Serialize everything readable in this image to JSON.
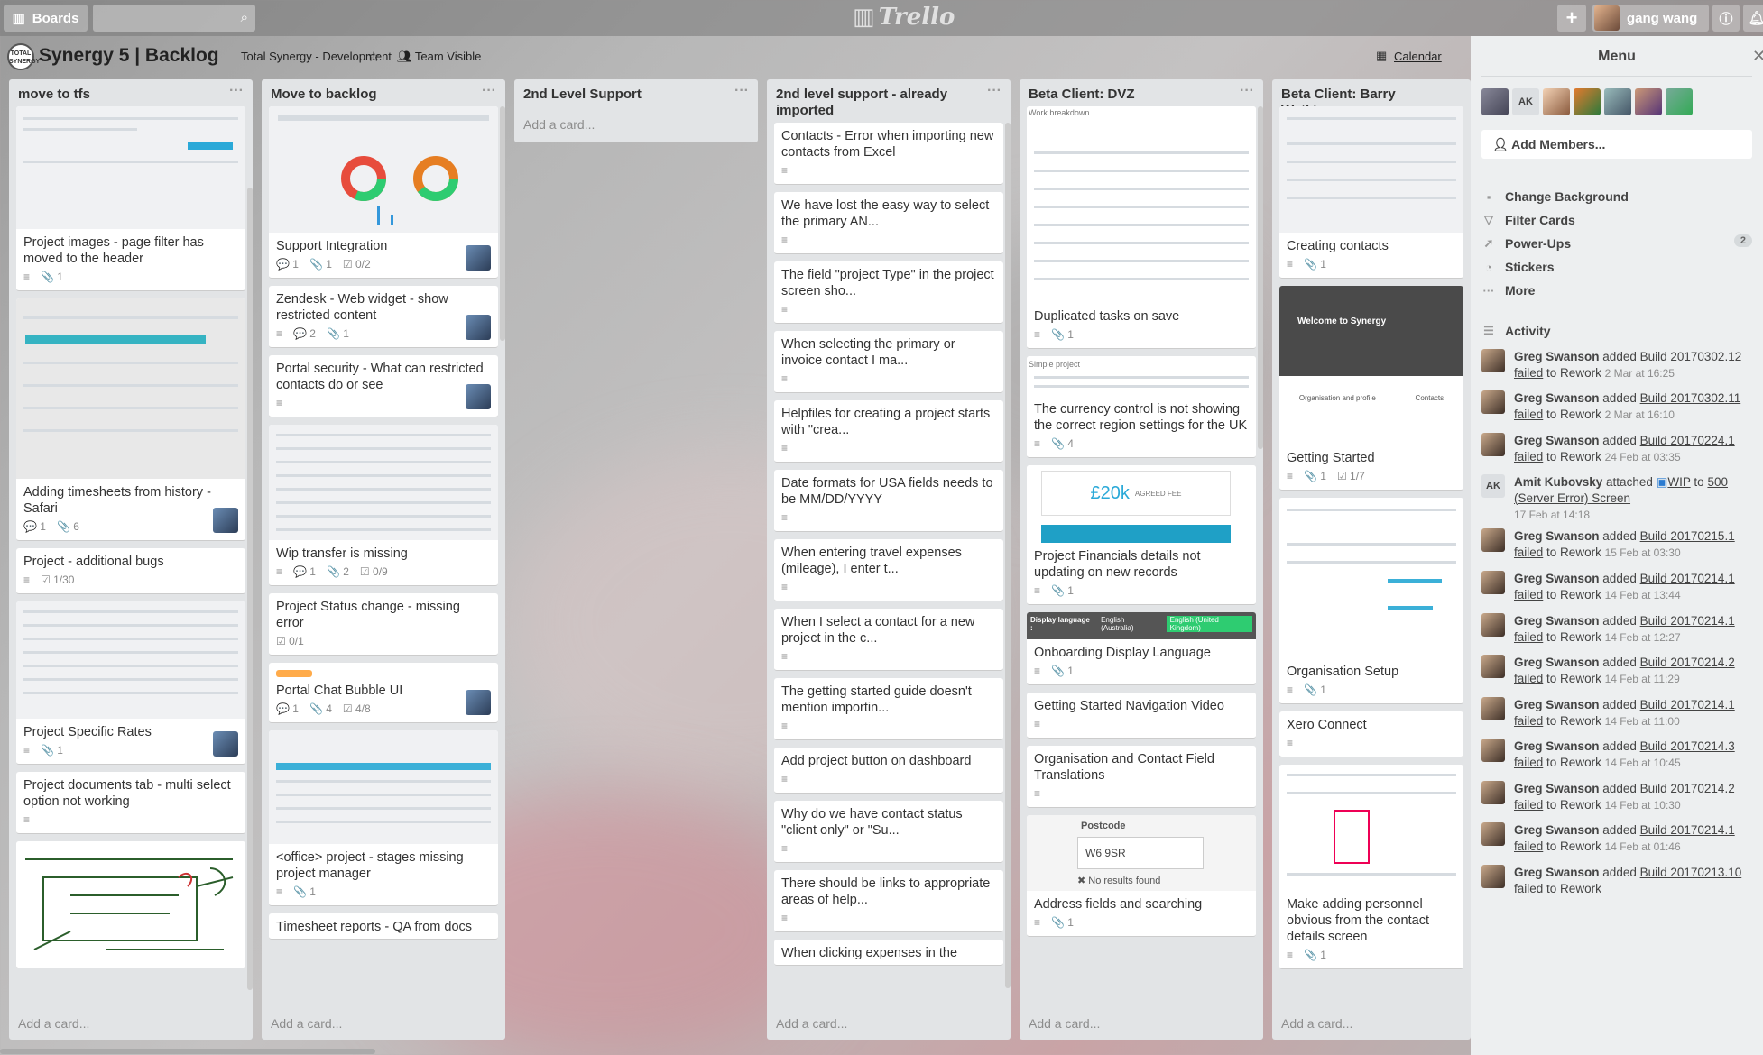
{
  "topbar": {
    "boards_label": "Boards",
    "logo_text": "Trello",
    "user_name": "gang wang"
  },
  "board": {
    "title": "Synergy 5 | Backlog",
    "org": "Total Synergy - Development",
    "visibility": "Team Visible",
    "calendar": "Calendar",
    "logo_text": "TOTAL SYNERGY"
  },
  "add_card": "Add a card...",
  "lists": [
    {
      "title": "move to tfs",
      "cards": [
        {
          "title": "Project images - page filter has moved to the header",
          "badges": [
            "≡",
            "📎 1"
          ]
        },
        {
          "title": "Adding timesheets from history - Safari",
          "badges": [
            "💬 1",
            "📎 6"
          ]
        },
        {
          "title": "Project - additional bugs",
          "badges": [
            "≡",
            "☑ 1/30"
          ]
        },
        {
          "title": "Project Specific Rates",
          "badges": [
            "≡",
            "📎 1"
          ]
        },
        {
          "title": "Project documents tab - multi select option not working",
          "badges": [
            "≡"
          ]
        }
      ]
    },
    {
      "title": "Move to backlog",
      "cards": [
        {
          "title": "Support Integration",
          "badges": [
            "💬 1",
            "📎 1",
            "☑ 0/2"
          ]
        },
        {
          "title": "Zendesk - Web widget - show restricted content",
          "badges": [
            "≡",
            "💬 2",
            "📎 1"
          ]
        },
        {
          "title": "Portal security - What can restricted contacts do or see",
          "badges": [
            "≡"
          ]
        },
        {
          "title": "Wip transfer is missing",
          "badges": [
            "≡",
            "💬 1",
            "📎 2",
            "☑ 0/9"
          ]
        },
        {
          "title": "Project Status change - missing error",
          "badges": [
            "☑ 0/1"
          ]
        },
        {
          "title": "Portal Chat Bubble UI",
          "badges": [
            "💬 1",
            "📎 4",
            "☑ 4/8"
          ]
        },
        {
          "title": "<office> project - stages missing project manager",
          "badges": [
            "≡",
            "📎 1"
          ]
        },
        {
          "title": "Timesheet reports - QA from docs",
          "badges": []
        }
      ]
    },
    {
      "title": "2nd Level Support",
      "cards": []
    },
    {
      "title": "2nd level support - already imported",
      "cards": [
        {
          "title": "Contacts - Error when importing new contacts from Excel"
        },
        {
          "title": "We have lost the easy way to select the primary AN..."
        },
        {
          "title": "The field \"project Type\" in the project screen sho..."
        },
        {
          "title": "When selecting the primary or invoice contact I ma..."
        },
        {
          "title": "Helpfiles for creating a project starts with \"crea..."
        },
        {
          "title": "Date formats for USA fields needs to be MM/DD/YYYY"
        },
        {
          "title": "When entering travel expenses (mileage), I enter t..."
        },
        {
          "title": "When I select a contact for a new project in the c..."
        },
        {
          "title": "The getting started guide doesn't mention importin..."
        },
        {
          "title": "Add project button on dashboard"
        },
        {
          "title": "Why do we have contact status \"client only\" or \"Su..."
        },
        {
          "title": "There should be links to appropriate areas of help..."
        },
        {
          "title": "When clicking expenses in the"
        }
      ]
    },
    {
      "title": "Beta Client: DVZ",
      "cards": [
        {
          "title": "Duplicated tasks on save",
          "badges": [
            "≡",
            "📎 1"
          ],
          "cover_caption": "Work breakdown"
        },
        {
          "title": "The currency control is not showing the correct region settings for the UK",
          "badges": [
            "≡",
            "📎 4"
          ],
          "cover_caption": "Simple project"
        },
        {
          "title": "Project Financials details not updating on new records",
          "badges": [
            "≡",
            "📎 1"
          ],
          "cover_amount": "£20k",
          "cover_sub": "AGREED FEE"
        },
        {
          "title": "Onboarding Display Language",
          "badges": [
            "≡",
            "📎 1"
          ],
          "cover_caption": "Display language :",
          "cover_opt1": "English (Australia)",
          "cover_opt2": "English (United Kingdom)"
        },
        {
          "title": "Getting Started Navigation Video",
          "badges": [
            "≡"
          ]
        },
        {
          "title": "Organisation and Contact Field Translations",
          "badges": [
            "≡"
          ]
        },
        {
          "title": "Address fields and searching",
          "badges": [
            "≡",
            "📎 1"
          ],
          "cover_caption": "Postcode",
          "cover_value": "W6 9SR",
          "cover_note": "✖ No results found"
        }
      ]
    },
    {
      "title": "Beta Client: Barry Watkins",
      "cards": [
        {
          "title": "Creating contacts",
          "badges": [
            "≡",
            "📎 1"
          ]
        },
        {
          "title": "Getting Started",
          "badges": [
            "≡",
            "📎 1",
            "☑ 1/7"
          ],
          "cover_caption": "Welcome to Synergy",
          "cover_left": "Organisation and profile",
          "cover_right": "Contacts"
        },
        {
          "title": "Organisation Setup",
          "badges": [
            "≡",
            "📎 1"
          ]
        },
        {
          "title": "Xero Connect",
          "badges": [
            "≡"
          ]
        },
        {
          "title": "Make adding personnel obvious from the contact details screen",
          "badges": [
            "≡",
            "📎 1"
          ]
        }
      ]
    }
  ],
  "menu": {
    "title": "Menu",
    "add_members": "Add Members...",
    "ak": "AK",
    "items": [
      "Change Background",
      "Filter Cards",
      "Power-Ups",
      "Stickers",
      "More"
    ],
    "powerups_count": "2",
    "activity_label": "Activity",
    "activity": [
      {
        "user": "Greg Swanson",
        "action": "added",
        "link": "Build 20170302.12",
        "rest_link": "failed",
        "rest": "to Rework",
        "time": "2 Mar at 16:25"
      },
      {
        "user": "Greg Swanson",
        "action": "added",
        "link": "Build 20170302.11",
        "rest_link": "failed",
        "rest": "to Rework",
        "time": "2 Mar at 16:10"
      },
      {
        "user": "Greg Swanson",
        "action": "added",
        "link": "Build 20170224.1",
        "rest_link": "failed",
        "rest": "to Rework",
        "time": "24 Feb at 03:35"
      },
      {
        "user": "Amit Kubovsky",
        "action": "attached",
        "link": "WIP",
        "rest_link": "500 (Server Error) Screen",
        "rest": "to",
        "time": "17 Feb at 14:18"
      },
      {
        "user": "Greg Swanson",
        "action": "added",
        "link": "Build 20170215.1",
        "rest_link": "failed",
        "rest": "to Rework",
        "time": "15 Feb at 03:30"
      },
      {
        "user": "Greg Swanson",
        "action": "added",
        "link": "Build 20170214.1",
        "rest_link": "failed",
        "rest": "to Rework",
        "time": "14 Feb at 13:44"
      },
      {
        "user": "Greg Swanson",
        "action": "added",
        "link": "Build 20170214.1",
        "rest_link": "failed",
        "rest": "to Rework",
        "time": "14 Feb at 12:27"
      },
      {
        "user": "Greg Swanson",
        "action": "added",
        "link": "Build 20170214.2",
        "rest_link": "failed",
        "rest": "to Rework",
        "time": "14 Feb at 11:29"
      },
      {
        "user": "Greg Swanson",
        "action": "added",
        "link": "Build 20170214.1",
        "rest_link": "failed",
        "rest": "to Rework",
        "time": "14 Feb at 11:00"
      },
      {
        "user": "Greg Swanson",
        "action": "added",
        "link": "Build 20170214.3",
        "rest_link": "failed",
        "rest": "to Rework",
        "time": "14 Feb at 10:45"
      },
      {
        "user": "Greg Swanson",
        "action": "added",
        "link": "Build 20170214.2",
        "rest_link": "failed",
        "rest": "to Rework",
        "time": "14 Feb at 10:30"
      },
      {
        "user": "Greg Swanson",
        "action": "added",
        "link": "Build 20170214.1",
        "rest_link": "failed",
        "rest": "to Rework",
        "time": "14 Feb at 01:46"
      },
      {
        "user": "Greg Swanson",
        "action": "added",
        "link": "Build 20170213.10",
        "rest_link": "failed",
        "rest": "to Rework",
        "time": ""
      }
    ]
  }
}
